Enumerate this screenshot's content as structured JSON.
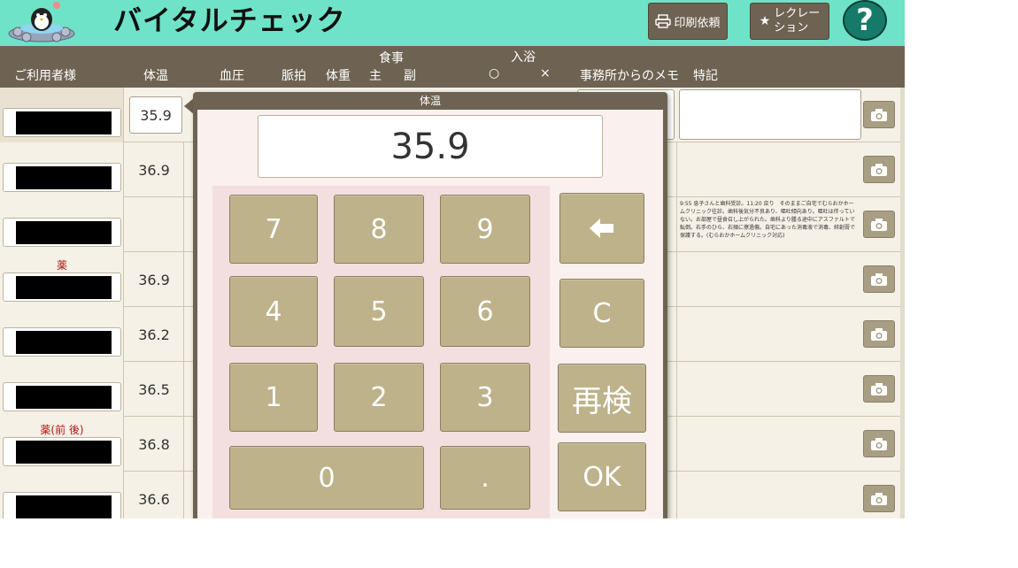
{
  "header": {
    "title": "バイタルチェック",
    "print_label": "印刷依頼",
    "recreation_label_line1": "レクレー",
    "recreation_label_line2": "ション",
    "help_label": "?"
  },
  "columns": {
    "user": "ご利用者様",
    "temp": "体温",
    "bp": "血圧",
    "pulse": "脈拍",
    "weight": "体重",
    "meal": "食事",
    "meal_main": "主",
    "meal_side": "副",
    "bath": "入浴",
    "bath_yes": "○",
    "bath_no": "×",
    "memo": "事務所からのメモ",
    "notes": "特記"
  },
  "rows": [
    {
      "tag": "",
      "temp": "35.9"
    },
    {
      "tag": "",
      "temp": "36.9"
    },
    {
      "tag": "",
      "temp": "",
      "memo": "9:55 息子さんと歯科受診。11:20 戻り　そのままご自宅でむらおかホームクリニック往診。歯科後気分不良あり、嘔吐傾向あり。嘔吐は伴っていない。お部屋で昼食召し上がられた。歯科より腫る途中にアスファルトで転倒。右手のひら、右頬に擦過傷。自宅にあった消毒液で消毒、絆創膏で保護する。(むらおかホームクリニック対応)"
    },
    {
      "tag": "薬",
      "temp": "36.9"
    },
    {
      "tag": "",
      "temp": "36.2"
    },
    {
      "tag": "",
      "temp": "36.5"
    },
    {
      "tag": "薬(前 後)",
      "temp": "36.8"
    },
    {
      "tag": "",
      "temp": "36.6"
    }
  ],
  "keypad": {
    "title": "体温",
    "display": "35.9",
    "keys": {
      "k7": "7",
      "k8": "8",
      "k9": "9",
      "k4": "4",
      "k5": "5",
      "k6": "6",
      "k1": "1",
      "k2": "2",
      "k3": "3",
      "k0": "0",
      "kdot": ".",
      "clear": "C",
      "recheck": "再検",
      "ok": "OK"
    }
  },
  "icons": {
    "camera": "camera-icon",
    "back": "backspace-arrow-icon",
    "print": "printer-icon",
    "star": "star-icon",
    "logo": "penguin-onsen-logo"
  },
  "colors": {
    "header_bg": "#6fe3c8",
    "bar_bg": "#6e6352",
    "key_bg": "#bdb28a",
    "pad_bg": "#f4dfe0",
    "tag_red": "#b01818"
  }
}
